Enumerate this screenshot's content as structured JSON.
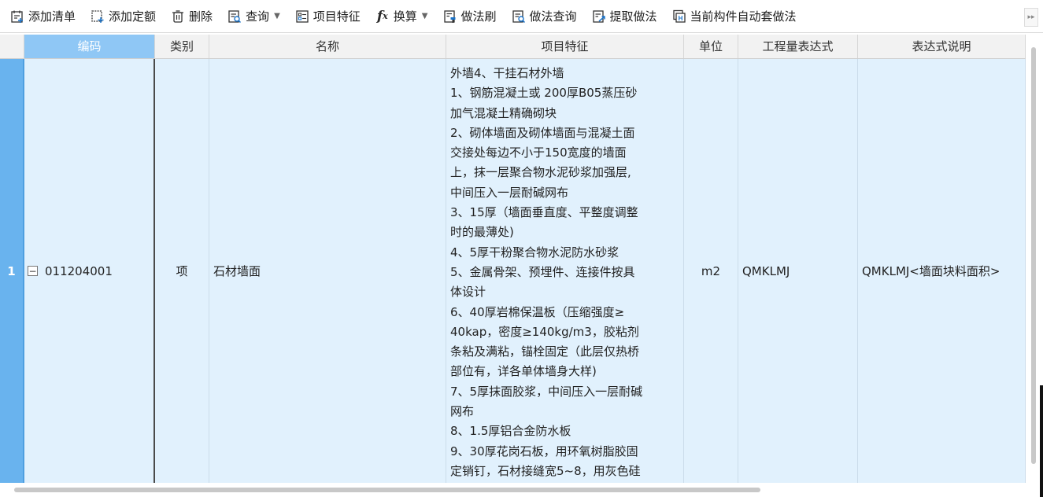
{
  "toolbar": {
    "add_list": "添加清单",
    "add_quota": "添加定额",
    "delete": "删除",
    "query": "查询",
    "item_feature": "项目特征",
    "convert": "换算",
    "method_brush": "做法刷",
    "method_query": "做法查询",
    "extract_method": "提取做法",
    "auto_apply": "当前构件自动套做法"
  },
  "columns": [
    "编码",
    "类别",
    "名称",
    "项目特征",
    "单位",
    "工程量表达式",
    "表达式说明"
  ],
  "rows": [
    {
      "num": "1",
      "code": "011204001",
      "category": "项",
      "name": "石材墙面",
      "feature_lines": [
        "外墙4、干挂石材外墙",
        "1、钢筋混凝土或 200厚B05蒸压砂",
        "加气混凝土精确砌块",
        "2、砌体墙面及砌体墙面与混凝土面",
        "交接处每边不小于150宽度的墙面",
        "上，抹一层聚合物水泥砂浆加强层,",
        "中间压入一层耐碱网布",
        "3、15厚（墙面垂直度、平整度调整",
        "时的最薄处)",
        "4、5厚干粉聚合物水泥防水砂浆",
        "5、金属骨架、预埋件、连接件按具",
        "体设计",
        "6、40厚岩棉保温板（压缩强度≥",
        "40kap，密度≥140kg/m3，胶粘剂",
        "条粘及满粘，锚栓固定（此层仅热桥",
        "部位有，详各单体墙身大样)",
        "7、5厚抹面胶浆，中间压入一层耐碱",
        "网布",
        "8、1.5厚铝合金防水板",
        "9、30厚花岗石板，用环氧树脂胶固",
        "定销钉，石材接缝宽5~8，用灰色硅"
      ],
      "unit": "m2",
      "expression": "QMKLMJ",
      "expression_desc": "QMKLMJ<墙面块料面积>"
    }
  ]
}
